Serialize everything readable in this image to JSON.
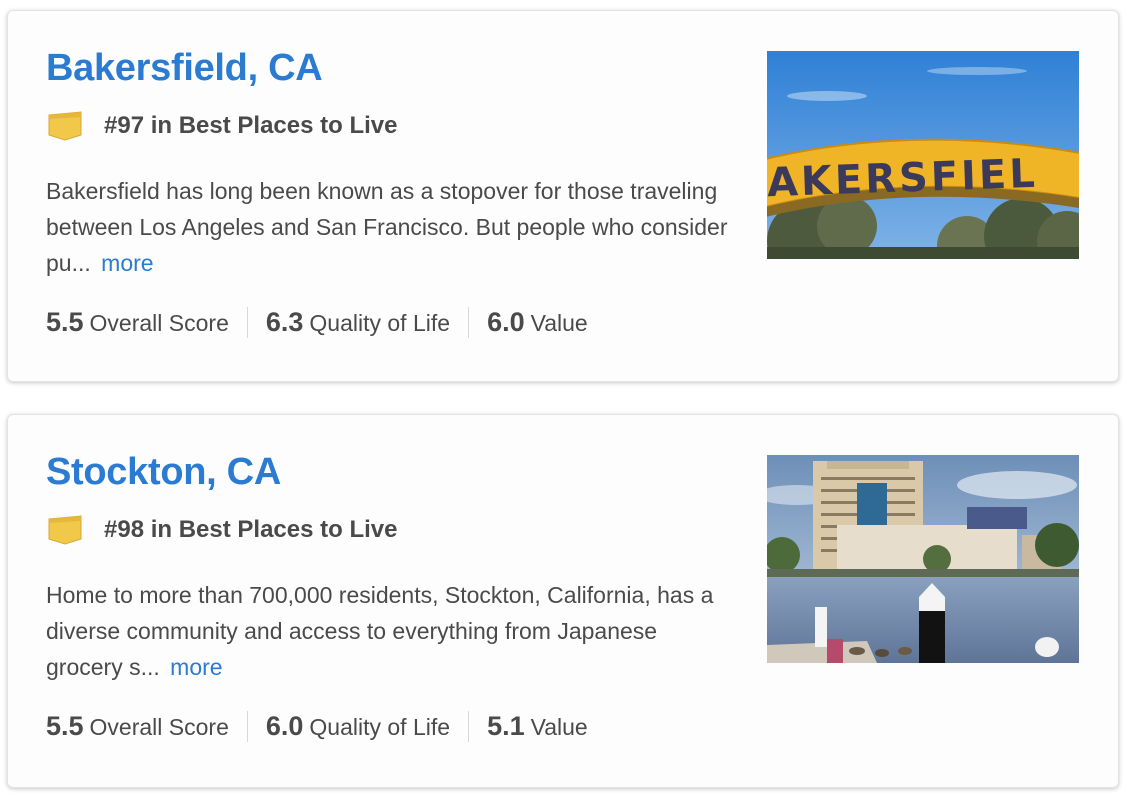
{
  "cards": [
    {
      "city": "Bakersfield, CA",
      "rank": "#97 in Best Places to Live",
      "description": "Bakersfield has long been known as a stopover for those traveling between Los Angeles and San Francisco. But people who consider pu...",
      "more": "more",
      "scores": [
        {
          "value": "5.5",
          "label": "Overall Score"
        },
        {
          "value": "6.3",
          "label": "Quality of Life"
        },
        {
          "value": "6.0",
          "label": "Value"
        }
      ],
      "photo": {
        "sign_text": "AKERSFIEL"
      }
    },
    {
      "city": "Stockton, CA",
      "rank": "#98 in Best Places to Live",
      "description": "Home to more than 700,000 residents, Stockton, California, has a diverse community and access to everything from Japanese grocery s...",
      "more": "more",
      "scores": [
        {
          "value": "5.5",
          "label": "Overall Score"
        },
        {
          "value": "6.0",
          "label": "Quality of Life"
        },
        {
          "value": "5.1",
          "label": "Value"
        }
      ]
    }
  ],
  "colors": {
    "link": "#2a7bd1",
    "badge": "#f2c84b",
    "text": "#4a4a4a"
  },
  "icons": {
    "rank_badge": "ribbon-badge-icon"
  }
}
